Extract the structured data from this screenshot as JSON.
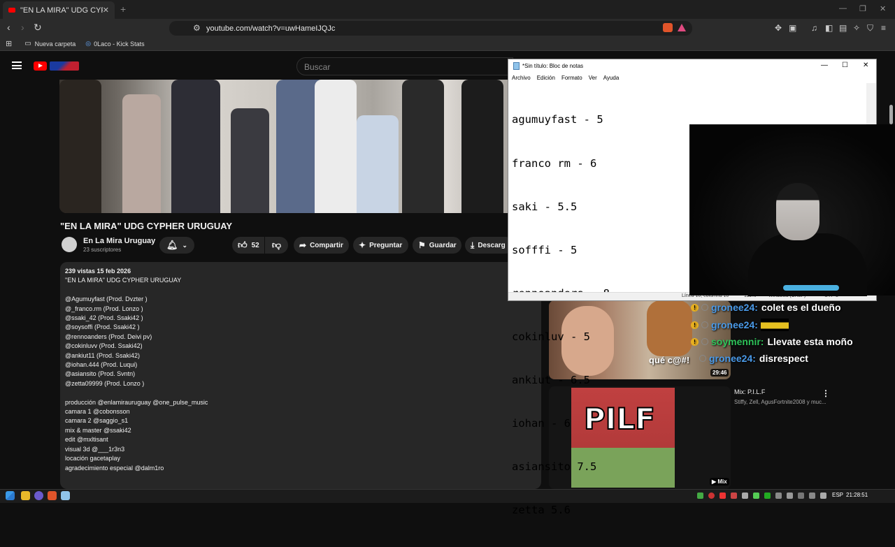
{
  "browser": {
    "tab_title": "\"EN LA MIRA\" UDG CYPHER URU...",
    "url": "youtube.com/watch?v=uwHameIJQJc",
    "bookmarks": [
      "Nueva carpeta",
      "0Laco - Kick Stats"
    ]
  },
  "youtube": {
    "search_placeholder": "Buscar",
    "video_title": "\"EN LA MIRA\" UDG CYPHER URUGUAY",
    "channel_name": "En La Mira Uruguay",
    "subscribers": "23 suscriptores",
    "likes": "52",
    "actions": {
      "share": "Compartir",
      "ask": "Preguntar",
      "save": "Guardar",
      "download": "Descarg"
    },
    "description": {
      "meta": "239 vistas  15 feb 2026",
      "title_line": "\"EN LA MIRA\" UDG CYPHER URUGUAY",
      "artists": [
        "@Agumuyfast (Prod. Dvzter )",
        "@_franco.rm  (Prod. Lonzo  )",
        "@ssaki_42 (Prod. Ssaki42  )",
        "@soysoffi  (Prod. Ssaki42  )",
        "@rennoanders (Prod. Deivi pv)",
        "@cokinluvv (Prod. Ssaki42)",
        "@ankiut11 (Prod. Ssaki42)",
        "@iohan.444 (Prod. Luqui)",
        "@asiansito (Prod. Svntn)",
        "@zetta09999 (Prod. Lonzo )"
      ],
      "credits": [
        "producción @enlamirauruguay @one_pulse_music",
        "camara 1 @cobonsson",
        "camara 2 @saggio_s1",
        "mix & master @ssaki42",
        "edit @mxltisant",
        "visual 3d @___1r3n3",
        "locación gacetaplay",
        "agradecimiento especial @dalm1ro"
      ]
    },
    "recommendations": {
      "thumb1_caption": "qué c@#!",
      "thumb1_duration": "29:46",
      "mix_title": "Mix: P.I.L.F",
      "mix_subtitle": "Stiffy, Zell, AgusFortnite2008 y muc...",
      "mix_badge": "Mix",
      "mix_art_text": "PILF"
    }
  },
  "chat": [
    {
      "user": "gronee24:",
      "message": "colet es el dueño",
      "color": "#4a9ae8"
    },
    {
      "user": "gronee24:",
      "message": "",
      "color": "#4a9ae8"
    },
    {
      "user": "soymennir:",
      "message": "Llevate esta moño",
      "color": "#2ec45a"
    },
    {
      "user": "gronee24:",
      "message": "disrespect",
      "color": "#4a9ae8"
    }
  ],
  "notepad": {
    "title": "*Sin título: Bloc de notas",
    "menu": [
      "Archivo",
      "Edición",
      "Formato",
      "Ver",
      "Ayuda"
    ],
    "lines": [
      "agumuyfast - 5",
      "franco rm - 6",
      "saki - 5.5",
      "sofffi - 5",
      "rennoanders - 8",
      "cokinluv - 5",
      "ankiut - 6.5",
      "iohan - 6",
      "asiansito 7.5",
      "zetta 5.6"
    ],
    "status_position": "Línea 10, columna 10",
    "status_zoom": "110%",
    "status_eol": "Windows (CRLF)",
    "status_encoding": "UTF-8"
  },
  "taskbar": {
    "language": "ESP",
    "time": "21:28:51"
  }
}
